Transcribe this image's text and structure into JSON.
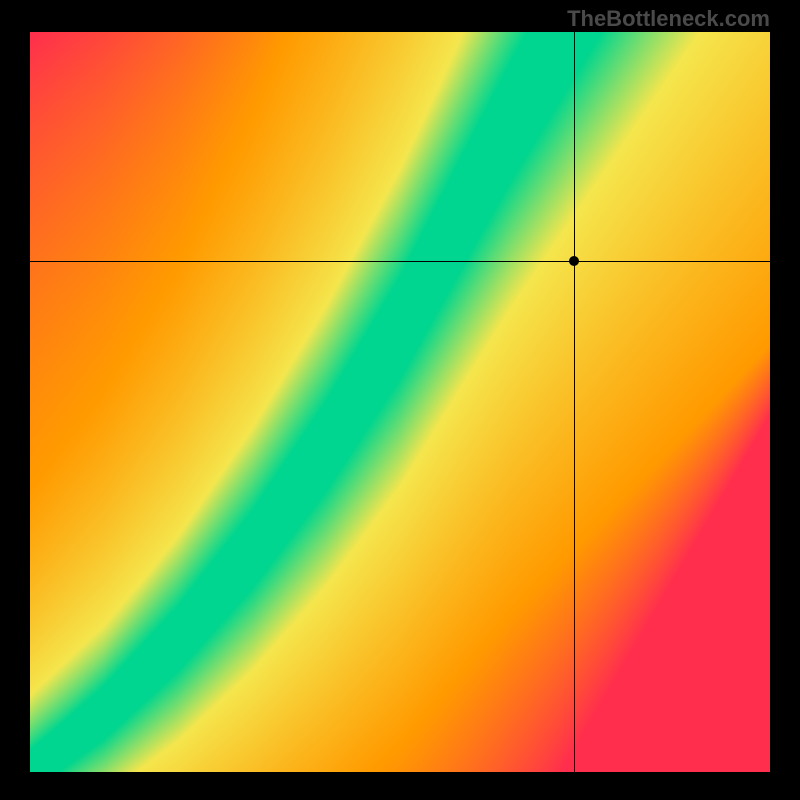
{
  "attribution": "TheBottleneck.com",
  "chart_data": {
    "type": "heatmap",
    "title": "",
    "xlabel": "",
    "ylabel": "",
    "xlim": [
      0,
      1
    ],
    "ylim": [
      0,
      1
    ],
    "marker": {
      "x": 0.735,
      "y": 0.69
    },
    "crosshair": {
      "x": 0.735,
      "y": 0.69
    },
    "optimal_curve": [
      {
        "x": 0.0,
        "y": 0.0
      },
      {
        "x": 0.1,
        "y": 0.08
      },
      {
        "x": 0.2,
        "y": 0.18
      },
      {
        "x": 0.3,
        "y": 0.3
      },
      {
        "x": 0.4,
        "y": 0.44
      },
      {
        "x": 0.5,
        "y": 0.6
      },
      {
        "x": 0.58,
        "y": 0.75
      },
      {
        "x": 0.65,
        "y": 0.88
      },
      {
        "x": 0.72,
        "y": 1.0
      }
    ],
    "colors": {
      "optimal": "#00d68f",
      "near": "#f5e64d",
      "mid": "#ff9a00",
      "far": "#ff2e4d"
    },
    "description": "Heatmap showing bottleneck severity. Green diagonal band = balanced; red = severe bottleneck. Crosshair marks a specific configuration slightly right of the green band."
  }
}
